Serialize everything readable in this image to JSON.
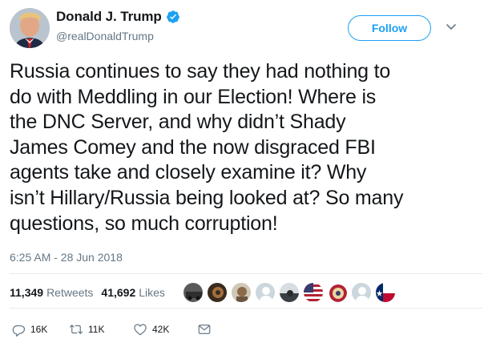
{
  "user": {
    "display_name": "Donald J. Trump",
    "handle": "@realDonaldTrump",
    "verified": true
  },
  "header": {
    "follow_label": "Follow"
  },
  "tweet": {
    "text_lines": [
      "Russia continues to say they had nothing to",
      "do with Meddling in our Election! Where is",
      "the DNC Server, and why didn’t Shady",
      "James Comey and the now disgraced FBI",
      "agents take and closely examine it? Why",
      "isn’t Hillary/Russia being looked at? So many",
      "questions, so much corruption!"
    ],
    "timestamp": "6:25 AM - 28 Jun 2018"
  },
  "stats": {
    "retweets_count": "11,349",
    "retweets_label": "Retweets",
    "likes_count": "41,692",
    "likes_label": "Likes"
  },
  "actions": {
    "reply_count": "16K",
    "retweet_count": "11K",
    "like_count": "42K"
  },
  "colors": {
    "accent": "#1da1f2",
    "muted": "#657786",
    "text": "#14171a"
  }
}
